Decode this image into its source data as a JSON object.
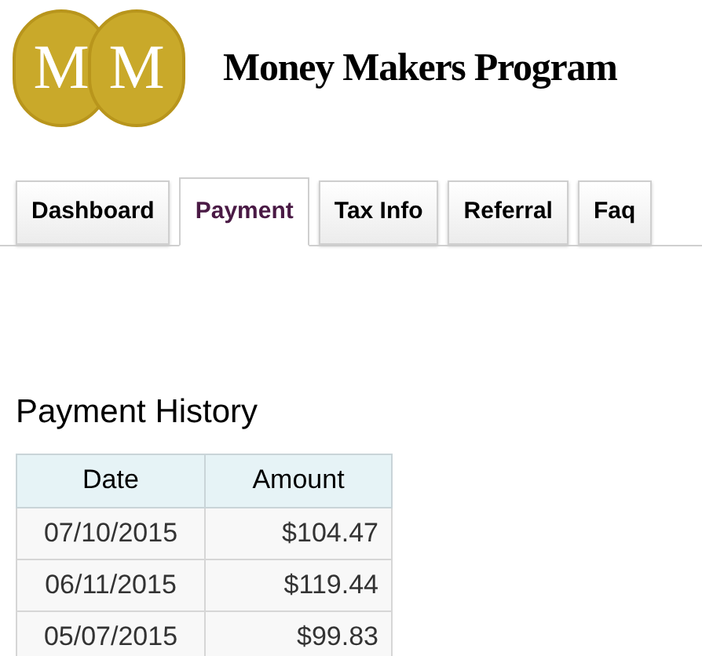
{
  "header": {
    "logo_letters": [
      "M",
      "M"
    ],
    "title": "Money Makers Program"
  },
  "tabs": [
    {
      "label": "Dashboard",
      "selected": false
    },
    {
      "label": "Payment",
      "selected": true
    },
    {
      "label": "Tax Info",
      "selected": false
    },
    {
      "label": "Referral",
      "selected": false
    },
    {
      "label": "Faq",
      "selected": false
    }
  ],
  "payment_history": {
    "title": "Payment History",
    "columns": [
      "Date",
      "Amount"
    ],
    "rows": [
      [
        "07/10/2015",
        "$104.47"
      ],
      [
        "06/11/2015",
        "$119.44"
      ],
      [
        "05/07/2015",
        "$99.83"
      ]
    ]
  }
}
